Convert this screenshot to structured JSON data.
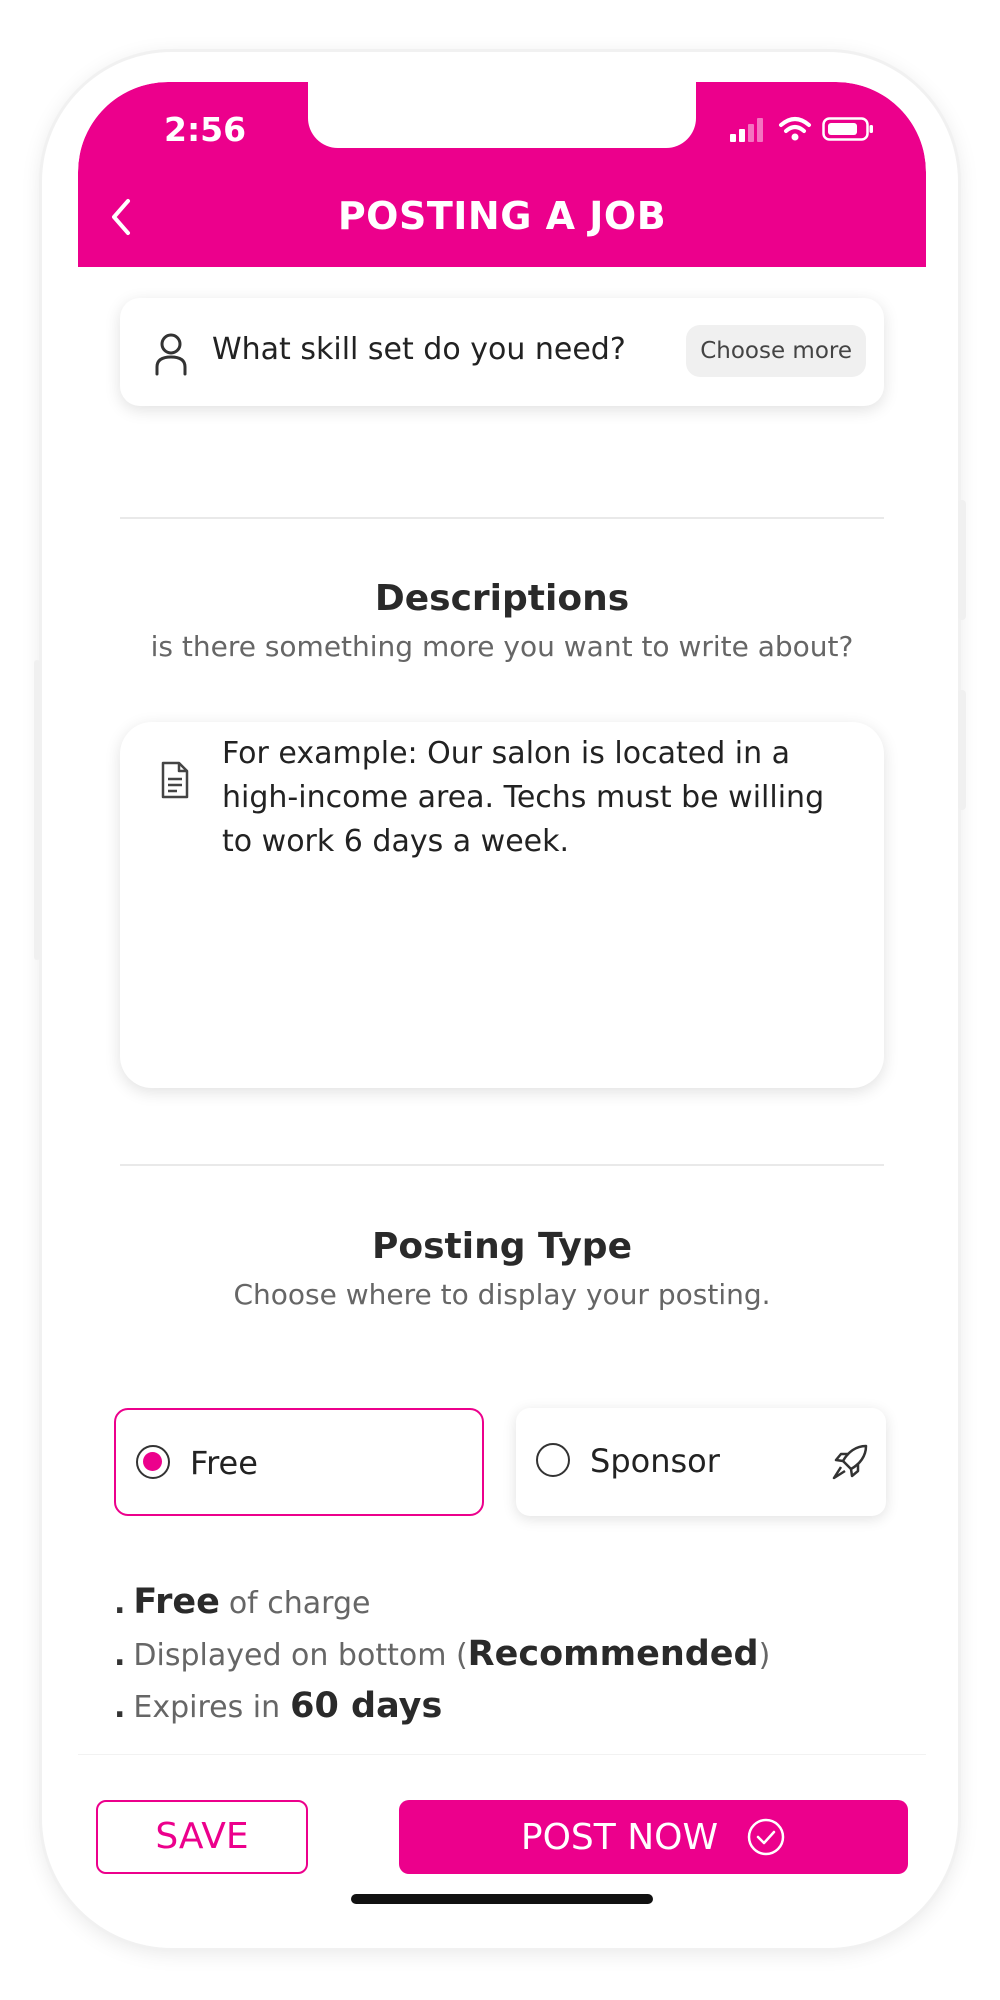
{
  "status_bar": {
    "time": "2:56"
  },
  "header": {
    "title": "POSTING A JOB"
  },
  "skill": {
    "question": "What skill set do you need?",
    "choose_more_label": "Choose more"
  },
  "descriptions": {
    "title": "Descriptions",
    "subtitle": "is there something more you want to write about?",
    "placeholder": "For example: Our salon is located in a high-income area. Techs must be willing to work 6 days a week."
  },
  "posting_type": {
    "title": "Posting Type",
    "subtitle": "Choose where to display your posting.",
    "options": [
      {
        "label": "Free",
        "selected": true
      },
      {
        "label": "Sponsor",
        "selected": false,
        "icon": "rocket-icon"
      }
    ]
  },
  "benefits": {
    "b1_strong": "Free",
    "b1_rest": "of charge",
    "b2_pre": "Displayed on bottom (",
    "b2_strong": "Recommended",
    "b2_post": ")",
    "b3_pre": "Expires in",
    "b3_strong": "60 days"
  },
  "footer": {
    "save_label": "SAVE",
    "post_label": "POST NOW"
  },
  "colors": {
    "accent": "#ec008c",
    "text": "#222222",
    "muted": "#666666"
  }
}
